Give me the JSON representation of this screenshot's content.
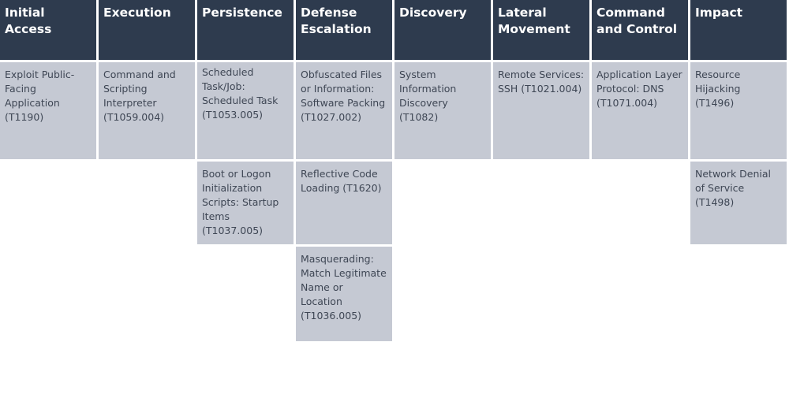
{
  "matrix": {
    "tactics": [
      {
        "name": "Initial Access",
        "techniques": [
          "Exploit Public-Facing Application (T1190)"
        ]
      },
      {
        "name": "Execution",
        "techniques": [
          "Command and Scripting Interpreter (T1059.004)"
        ]
      },
      {
        "name": "Persistence",
        "techniques": [
          "Scheduled Task/Job: Scheduled Task (T1053.005)",
          "Boot or Logon Initialization Scripts: Startup Items (T1037.005)"
        ]
      },
      {
        "name": "Defense Escalation",
        "techniques": [
          "Obfuscated Files or Information: Software Packing (T1027.002)",
          "Reflective Code Loading (T1620)",
          "Masquerading: Match Legitimate Name or Location (T1036.005)"
        ]
      },
      {
        "name": "Discovery",
        "techniques": [
          "System Information Discovery (T1082)"
        ]
      },
      {
        "name": "Lateral Movement",
        "techniques": [
          "Remote Services: SSH (T1021.004)"
        ]
      },
      {
        "name": "Command and Control",
        "techniques": [
          "Application Layer Protocol: DNS (T1071.004)"
        ]
      },
      {
        "name": "Impact",
        "techniques": [
          "Resource Hijacking (T1496)",
          "Network Denial of Service (T1498)"
        ]
      }
    ]
  },
  "colors": {
    "header_bg": "#2e3b4e",
    "header_text": "#ffffff",
    "cell_bg": "#c5c9d3",
    "cell_text": "#3e4654"
  }
}
